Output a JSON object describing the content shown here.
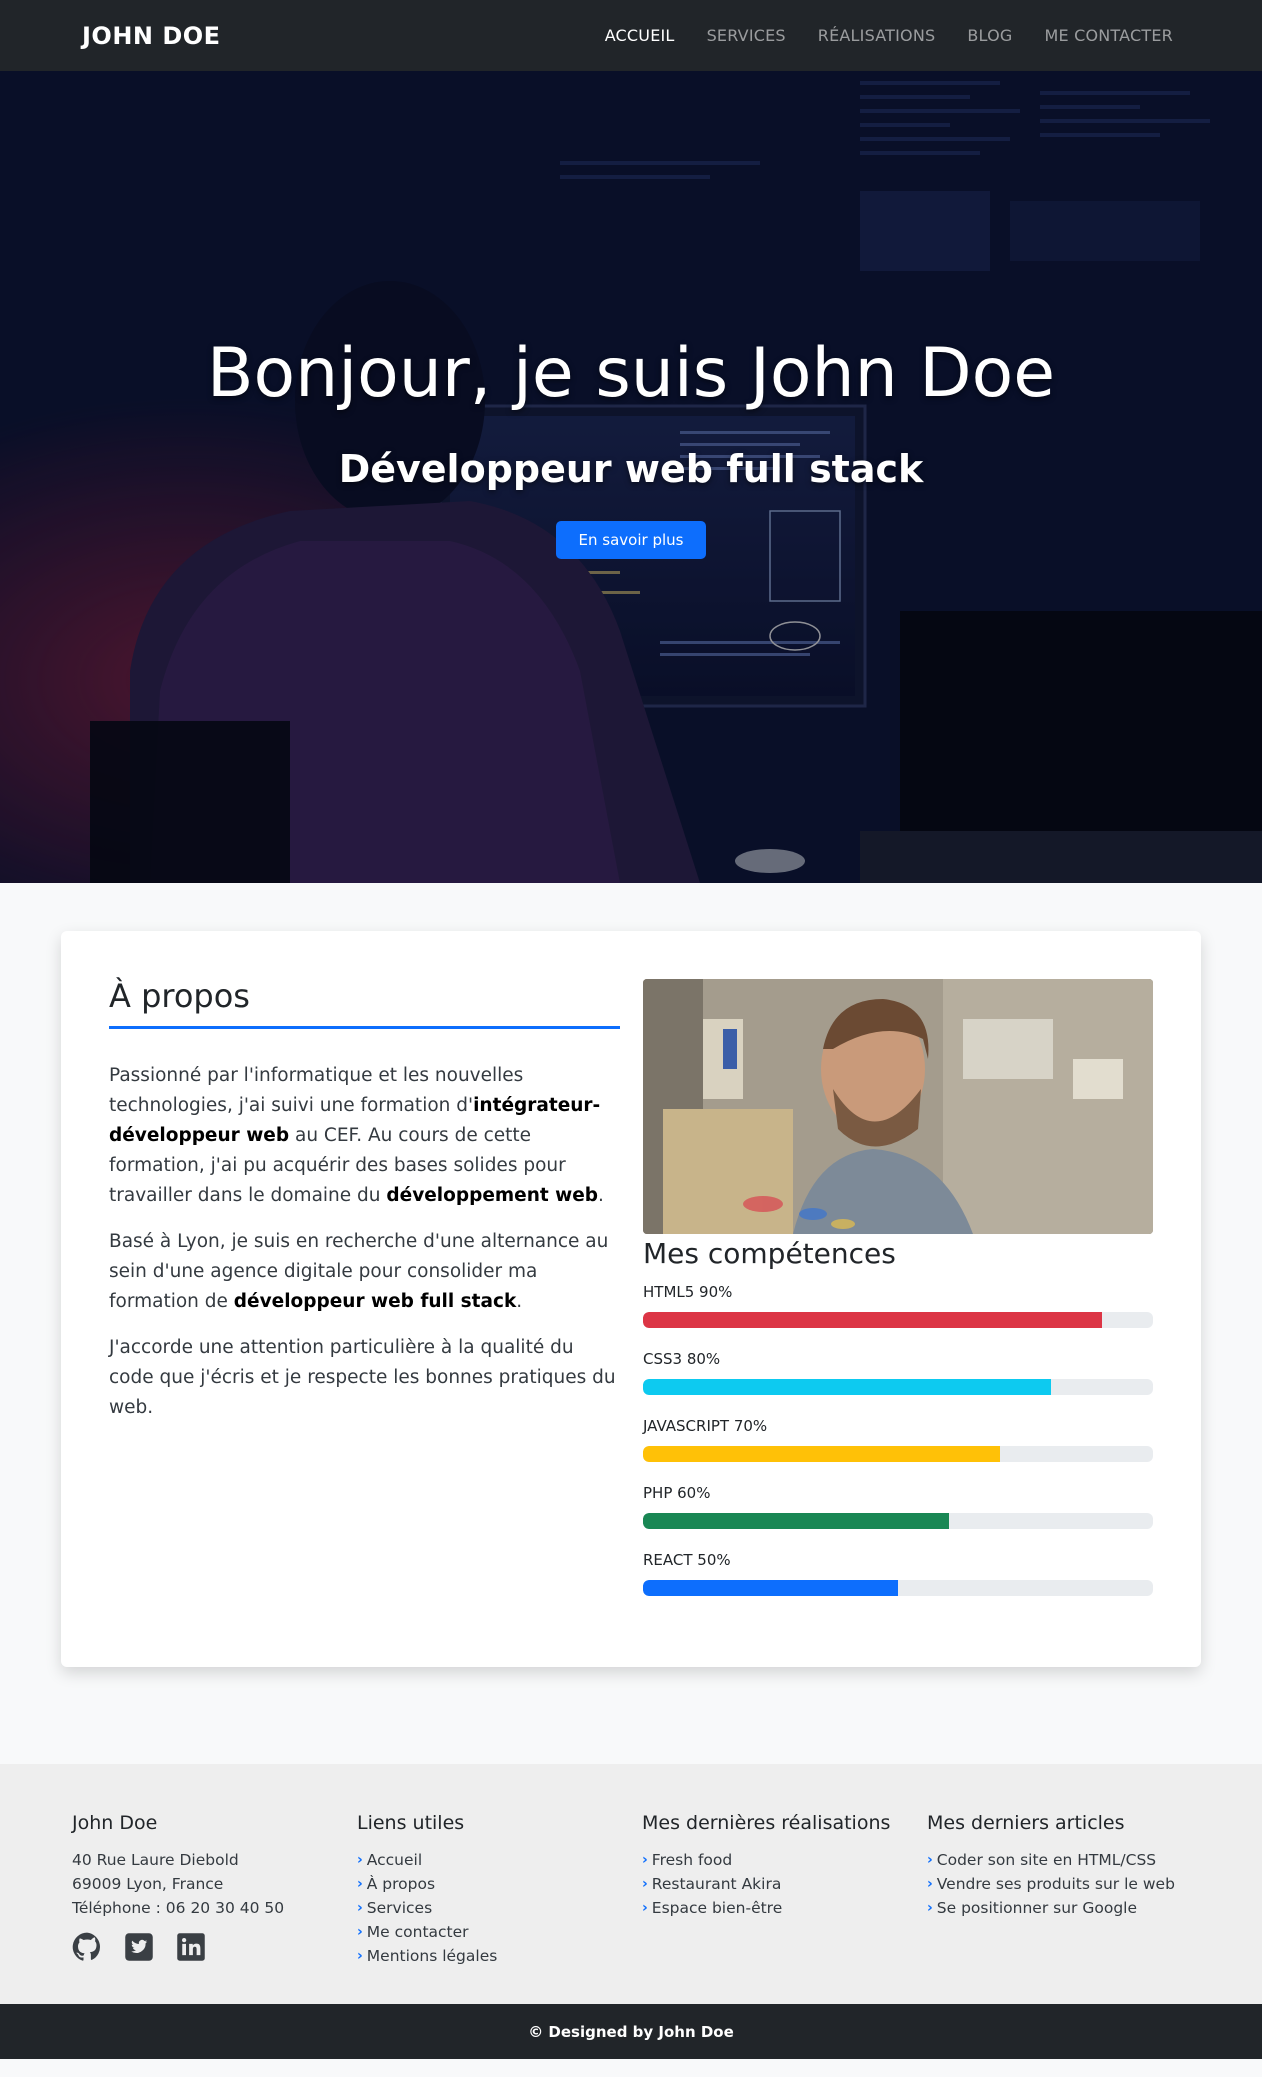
{
  "navbar": {
    "brand": "JOHN DOE",
    "links": [
      "ACCUEIL",
      "SERVICES",
      "RÉALISATIONS",
      "BLOG",
      "ME CONTACTER"
    ],
    "active": "ACCUEIL"
  },
  "hero": {
    "title": "Bonjour, je suis John Doe",
    "subtitle": "Développeur web full stack",
    "button": "En savoir plus"
  },
  "about": {
    "title": "À propos",
    "p1_a": "Passionné par l'informatique et les nouvelles technologies, j'ai suivi une formation d'",
    "p1_b": "intégrateur-développeur web",
    "p1_c": " au CEF. Au cours de cette formation, j'ai pu acquérir des bases solides pour travailler dans le domaine du ",
    "p1_d": "développement web",
    "p1_e": ".",
    "p2_a": "Basé à Lyon, je suis en recherche d'une alternance au sein d'une agence digitale pour consolider ma formation de ",
    "p2_b": "développeur web full stack",
    "p2_c": ".",
    "p3": "J'accorde une attention particulière à la qualité du code que j'écris et je respecte les bonnes pratiques du web."
  },
  "skills": {
    "title": "Mes compétences",
    "items": [
      {
        "label": "HTML5 90%",
        "level": 0.9,
        "color": "#dc3545"
      },
      {
        "label": "CSS3 80%",
        "level": 0.8,
        "color": "#0dcaf0"
      },
      {
        "label": "JAVASCRIPT 70%",
        "level": 0.7,
        "color": "#ffc107"
      },
      {
        "label": "PHP 60%",
        "level": 0.6,
        "color": "#198754"
      },
      {
        "label": "REACT 50%",
        "level": 0.5,
        "color": "#0d6efd"
      }
    ]
  },
  "footer": {
    "contact": {
      "name": "John Doe",
      "address1": "40 Rue Laure Diebold",
      "address2": "69009 Lyon, France",
      "phone": "Téléphone : 06 20 30 40 50",
      "socials": [
        "github-icon",
        "twitter-icon",
        "linkedin-icon"
      ]
    },
    "links": {
      "title": "Liens utiles",
      "items": [
        "Accueil",
        "À propos",
        "Services",
        "Me contacter",
        "Mentions légales"
      ]
    },
    "works": {
      "title": "Mes dernières réalisations",
      "items": [
        "Fresh food",
        "Restaurant Akira",
        "Espace bien-être"
      ]
    },
    "articles": {
      "title": "Mes derniers articles",
      "items": [
        "Coder son site en HTML/CSS",
        "Vendre ses produits sur le web",
        "Se positionner sur Google"
      ]
    },
    "copyright": "© Designed by John Doe"
  },
  "colors": {
    "primary": "#0d6efd",
    "dark": "#212529",
    "footer_bg": "#eeeeee"
  }
}
